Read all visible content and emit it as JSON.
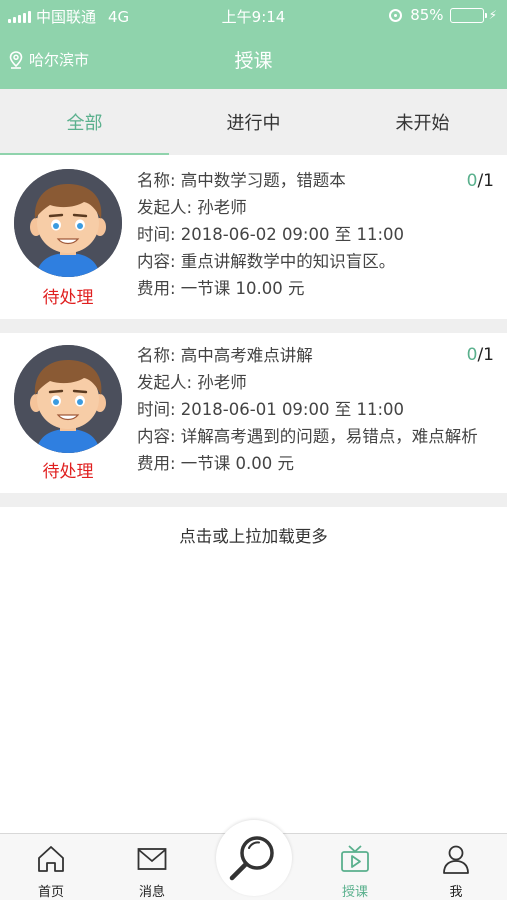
{
  "status_bar": {
    "carrier": "中国联通",
    "network": "4G",
    "time": "上午9:14",
    "battery_percent": "85%",
    "battery_level": 0.85
  },
  "nav": {
    "location": "哈尔滨市",
    "title": "授课"
  },
  "tabs": [
    {
      "label": "全部",
      "active": true
    },
    {
      "label": "进行中",
      "active": false
    },
    {
      "label": "未开始",
      "active": false
    }
  ],
  "lessons": [
    {
      "status": "待处理",
      "count_done": "0",
      "count_total": "/1",
      "name": "名称: 高中数学习题，错题本",
      "initiator": "发起人: 孙老师",
      "time": "时间: 2018-06-02 09:00 至 11:00",
      "content": "内容: 重点讲解数学中的知识盲区。",
      "fee": "费用: 一节课 10.00 元"
    },
    {
      "status": "待处理",
      "count_done": "0",
      "count_total": "/1",
      "name": "名称: 高中高考难点讲解",
      "initiator": "发起人: 孙老师",
      "time": "时间: 2018-06-01 09:00 至 11:00",
      "content": "内容: 详解高考遇到的问题，易错点，难点解析",
      "fee": "费用: 一节课 0.00 元"
    }
  ],
  "load_more": "点击或上拉加载更多",
  "tabbar": {
    "home": "首页",
    "messages": "消息",
    "teaching": "授课",
    "me": "我"
  },
  "colors": {
    "header": "#8fd3ac",
    "accent": "#5ab08d",
    "status_pending": "#e02020"
  }
}
